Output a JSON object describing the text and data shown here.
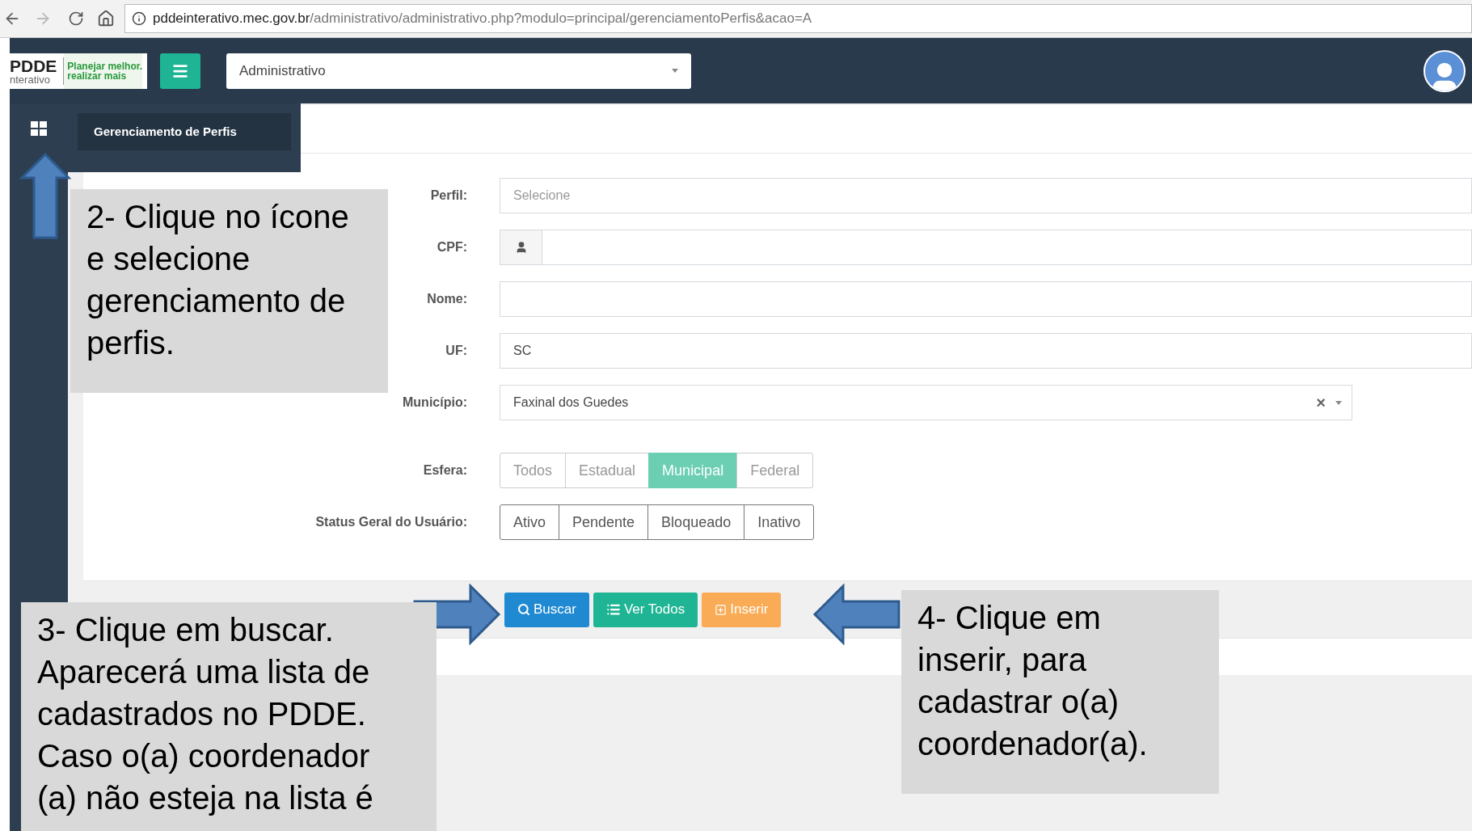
{
  "browser": {
    "url_host": "pddeinterativo.mec.gov.br",
    "url_path": "/administrativo/administrativo.php?modulo=principal/gerenciamentoPerfis&acao=A"
  },
  "header": {
    "logo_main": "PDDE",
    "logo_sub": "nterativo",
    "slogan_1": "Planejar melhor.",
    "slogan_2": "realizar mais",
    "module_select": "Administrativo"
  },
  "sidebar": {
    "menu_items": [
      {
        "label": "Gerenciamento de Perfis",
        "selected": true
      }
    ]
  },
  "form": {
    "fields": [
      {
        "label": "Perfil:",
        "kind": "select",
        "placeholder": "Selecione"
      },
      {
        "label": "CPF:",
        "kind": "cpf"
      },
      {
        "label": "Nome:",
        "kind": "text"
      },
      {
        "label": "UF:",
        "kind": "text",
        "value": "SC"
      },
      {
        "label": "Município:",
        "kind": "combo",
        "value": "Faxinal dos Guedes",
        "clear": "×"
      }
    ],
    "esfera": {
      "label": "Esfera:",
      "options": [
        {
          "label": "Todos",
          "selected": false
        },
        {
          "label": "Estadual",
          "selected": false
        },
        {
          "label": "Municipal",
          "selected": true
        },
        {
          "label": "Federal",
          "selected": false
        }
      ]
    },
    "status": {
      "label": "Status Geral do Usuário:",
      "options": [
        {
          "label": "Ativo",
          "selected": false
        },
        {
          "label": "Pendente",
          "selected": false
        },
        {
          "label": "Bloqueado",
          "selected": false
        },
        {
          "label": "Inativo",
          "selected": false
        }
      ]
    },
    "buttons": [
      {
        "label": "Buscar",
        "kind": "search"
      },
      {
        "label": "Ver Todos",
        "kind": "list"
      },
      {
        "label": "Inserir",
        "kind": "insert"
      }
    ]
  },
  "callouts": [
    {
      "kind": "icon",
      "text": "2- Clique no ícone e selecione gerenciamento de perfis."
    },
    {
      "kind": "search",
      "text": "3- Clique em buscar. Aparecerá uma lista de cadastrados no PDDE. Caso o(a) coordenador (a) não esteja na lista é"
    },
    {
      "kind": "insert",
      "text": "4- Clique em inserir, para cadastrar o(a) coordenador(a)."
    }
  ]
}
